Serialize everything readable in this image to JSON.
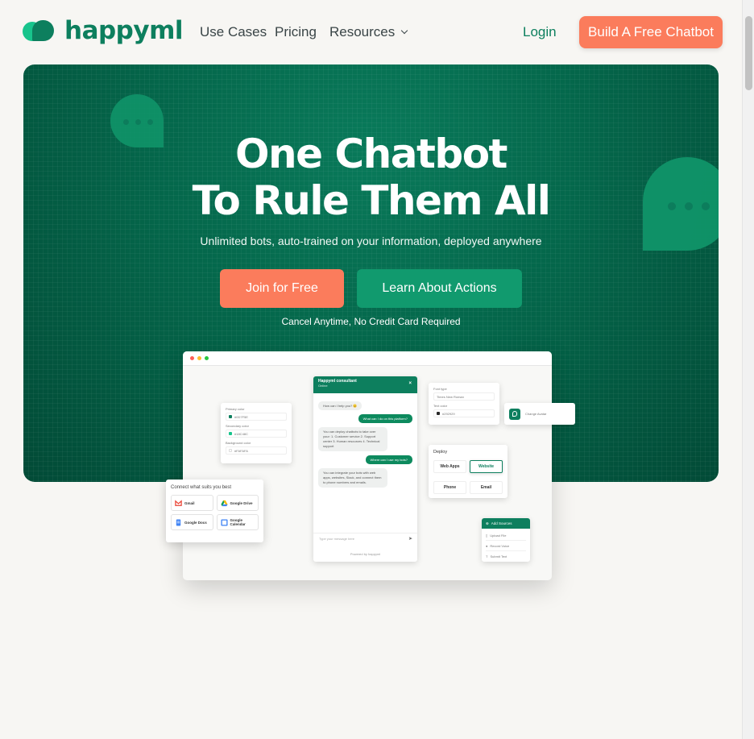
{
  "nav": {
    "logo_text": "happyml",
    "links": [
      "Use Cases",
      "Pricing",
      "Resources"
    ],
    "login": "Login",
    "cta": "Build A Free Chatbot"
  },
  "hero": {
    "title_line1": "One Chatbot",
    "title_line2": "To Rule Them All",
    "subtitle": "Unlimited bots, auto-trained on your information, deployed anywhere",
    "join_button": "Join for Free",
    "learn_button": "Learn About Actions",
    "note": "Cancel Anytime, No Credit Card Required"
  },
  "mockup": {
    "chat": {
      "title": "Happyml consultant",
      "status": "Online",
      "messages": [
        {
          "from": "bot",
          "text": "How can I help you? 😊"
        },
        {
          "from": "user",
          "text": "What can I do on this platform?"
        },
        {
          "from": "bot",
          "text": "You can deploy chatbots to take over your: 1. Customer service 2. Support center 3. Human resources 4. Technical support"
        },
        {
          "from": "user",
          "text": "Where can I use my bots?"
        },
        {
          "from": "bot",
          "text": "You can integrate your bots with web apps, websites, Slack, and connect them to phone numbers and emails."
        }
      ],
      "input_placeholder": "Type your message here",
      "powered_by": "Powered by happyml"
    },
    "colors_card": {
      "rows": [
        {
          "label": "Primary color",
          "value": "#0D7F5E"
        },
        {
          "label": "Secondary color",
          "value": "#18C48C"
        },
        {
          "label": "Background color",
          "value": "#FAFAFA"
        }
      ]
    },
    "font_card": {
      "font_label": "Font type",
      "font_value": "Times New Roman",
      "color_label": "Text color",
      "color_value": "#292929"
    },
    "avatar_card": {
      "label": "Change Avatar"
    },
    "deploy_card": {
      "title": "Deploy",
      "options": [
        "Web Apps",
        "Website",
        "Phone",
        "Email"
      ]
    },
    "sources_card": {
      "button": "Add Sources",
      "items": [
        "Upload File",
        "Record Voice",
        "Submit Text"
      ]
    },
    "connect_card": {
      "title": "Connect what suits you best",
      "items": [
        "Gmail",
        "Google Drive",
        "Google Docs",
        "Google Calendar"
      ]
    }
  },
  "colors": {
    "brand": "#0D7F5E",
    "accent": "#FB7C5C",
    "hero_bg": "#04664A"
  }
}
